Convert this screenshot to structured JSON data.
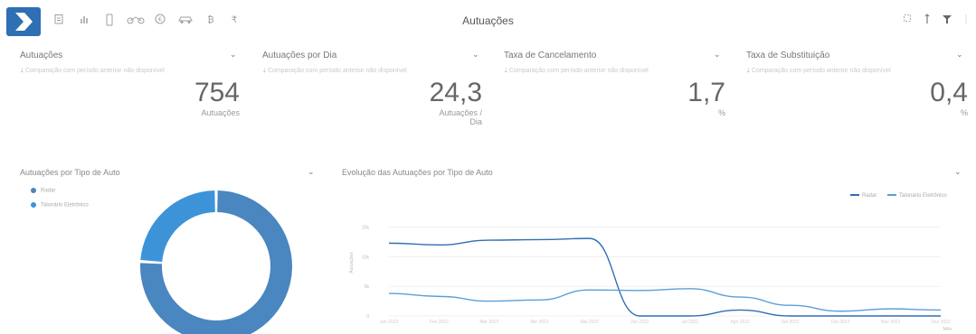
{
  "header": {
    "title": "Autuações",
    "toolbar_icons": [
      "clipboard-icon",
      "bar-chart-icon",
      "mobile-icon",
      "bike-icon",
      "coin-icon",
      "car-icon",
      "bitcoin-icon",
      "rupee-icon"
    ],
    "right_icons": [
      "expand-icon",
      "sort-icon",
      "filter-icon"
    ]
  },
  "kpis": [
    {
      "title": "Autuações",
      "subtitle": "Comparação com período anterior não disponível",
      "value": "754",
      "unit": "Autuações"
    },
    {
      "title": "Autuações por Dia",
      "subtitle": "Comparação com período anterior não disponível",
      "value": "24,3",
      "unit": "Autuações / Dia"
    },
    {
      "title": "Taxa de Cancelamento",
      "subtitle": "Comparação com período anterior não disponível",
      "value": "1,7",
      "unit": "%"
    },
    {
      "title": "Taxa de Substituição",
      "subtitle": "Comparação com período anterior não disponível",
      "value": "0,4",
      "unit": "%"
    }
  ],
  "colors": {
    "accent": "#2f6fb3",
    "series_a": "#4a86c0",
    "series_b": "#3c93d8",
    "kpi_arrow": "#e07a3f"
  },
  "donut": {
    "title": "Autuações por Tipo de Auto",
    "chart_data": {
      "type": "pie",
      "labels": [
        "Radar",
        "Talonário Eletrônico"
      ],
      "values": [
        76,
        24
      ],
      "colors": [
        "#4a86c0",
        "#3c93d8"
      ]
    }
  },
  "line": {
    "title": "Evolução das Autuações por Tipo de Auto",
    "chart_data": {
      "type": "line",
      "x": [
        "Jan 2022",
        "Fev 2022",
        "Mar 2022",
        "Abr 2022",
        "Mai 2022",
        "Jun 2022",
        "Jul 2022",
        "Ago 2022",
        "Set 2022",
        "Out 2022",
        "Nov 2022",
        "Dez 2022"
      ],
      "xlabel": "Mês",
      "ylabel": "Autuações",
      "yticks": [
        "0",
        "5k",
        "10k",
        "15k"
      ],
      "ylim": [
        0,
        18000
      ],
      "series": [
        {
          "name": "Radar",
          "values": [
            12300,
            12000,
            12800,
            12900,
            13100,
            0,
            0,
            1000,
            0,
            0,
            0,
            0
          ]
        },
        {
          "name": "Talonário Eletrônico",
          "values": [
            3800,
            3300,
            2500,
            2700,
            4400,
            4300,
            4600,
            3200,
            1800,
            800,
            1200,
            1000
          ]
        }
      ],
      "colors": [
        "#2f6fb3",
        "#5aa0d8"
      ],
      "legend_position": "top-right"
    }
  }
}
